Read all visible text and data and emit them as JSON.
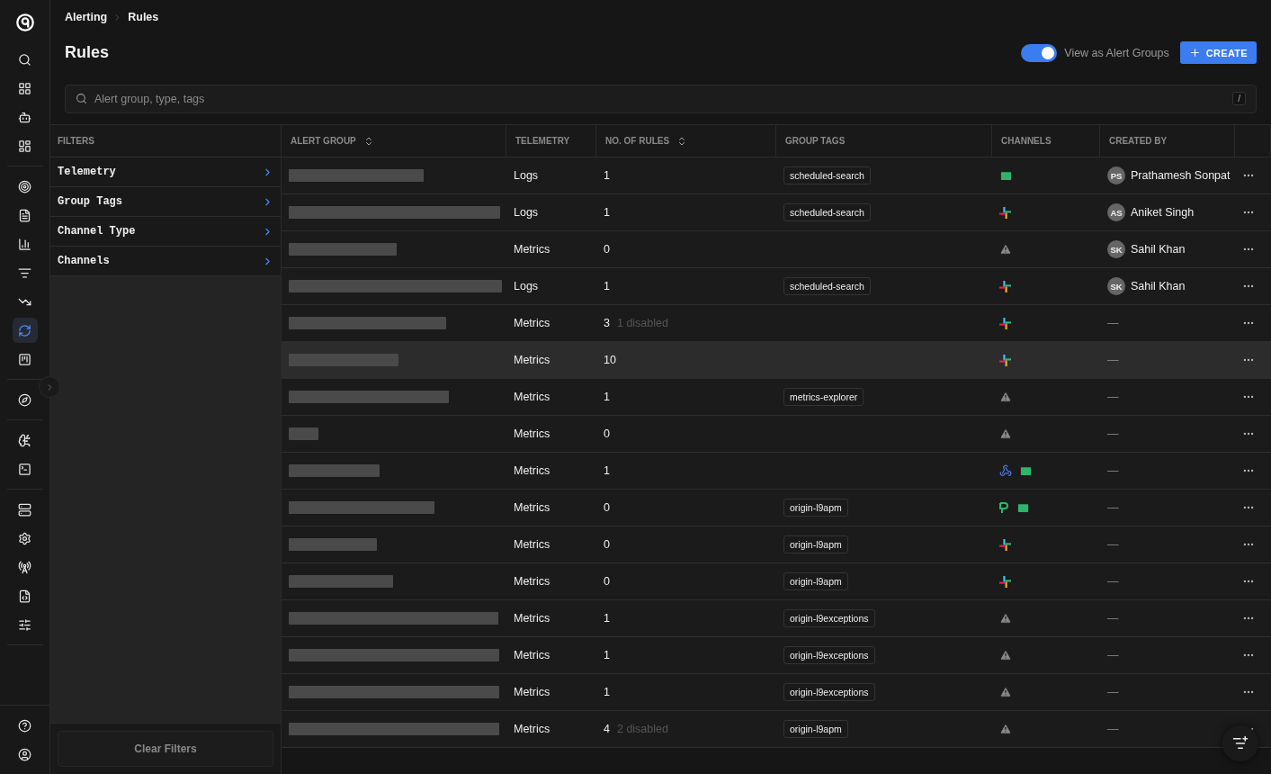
{
  "nav": {
    "top": [
      {
        "kind": "search",
        "selected": false
      },
      {
        "kind": "apps",
        "selected": false
      },
      {
        "kind": "bot",
        "selected": false
      },
      {
        "kind": "dashboard",
        "selected": false
      }
    ],
    "groups": [
      [
        {
          "kind": "target",
          "selected": false
        },
        {
          "kind": "logs",
          "selected": false
        },
        {
          "kind": "chart",
          "selected": false
        },
        {
          "kind": "traces",
          "selected": false
        },
        {
          "kind": "trend",
          "selected": false
        },
        {
          "kind": "alert",
          "selected": true
        },
        {
          "kind": "board",
          "selected": false
        }
      ],
      [
        {
          "kind": "compass",
          "selected": false
        }
      ],
      [
        {
          "kind": "brain",
          "selected": false
        },
        {
          "kind": "terminal",
          "selected": false
        }
      ],
      [
        {
          "kind": "server",
          "selected": false
        },
        {
          "kind": "gear",
          "selected": false
        },
        {
          "kind": "radio",
          "selected": false
        },
        {
          "kind": "code",
          "selected": false
        },
        {
          "kind": "sliders",
          "selected": false
        }
      ]
    ],
    "bottom": [
      {
        "kind": "help",
        "selected": false
      },
      {
        "kind": "user",
        "selected": false
      }
    ]
  },
  "breadcrumb": [
    "Alerting",
    "Rules"
  ],
  "title": "Rules",
  "view_toggle": {
    "label": "View as Alert Groups",
    "on": true
  },
  "create_button": "CREATE",
  "search": {
    "placeholder": "Alert group, type, tags",
    "shortcut": "/"
  },
  "filters": {
    "heading": "FILTERS",
    "items": [
      "Telemetry",
      "Group Tags",
      "Channel Type",
      "Channels"
    ],
    "clear_button": "Clear Filters"
  },
  "table": {
    "columns": [
      {
        "label": "ALERT GROUP",
        "sortable": true
      },
      {
        "label": "TELEMETRY",
        "sortable": false
      },
      {
        "label": "NO. OF RULES",
        "sortable": true
      },
      {
        "label": "GROUP TAGS",
        "sortable": false
      },
      {
        "label": "CHANNELS",
        "sortable": false
      },
      {
        "label": "CREATED BY",
        "sortable": false
      }
    ],
    "rows": [
      {
        "telemetry": "Logs",
        "rules": "1",
        "tags": [
          "scheduled-search"
        ],
        "channels": [
          {
            "kind": "email"
          }
        ],
        "creator": {
          "initials": "PS",
          "name": "Prathamesh Sonpat"
        },
        "hovered": false
      },
      {
        "telemetry": "Logs",
        "rules": "1",
        "tags": [
          "scheduled-search"
        ],
        "channels": [
          {
            "kind": "slack"
          }
        ],
        "creator": {
          "initials": "AS",
          "name": "Aniket Singh"
        },
        "hovered": false
      },
      {
        "telemetry": "Metrics",
        "rules": "0",
        "tags": [],
        "channels": [
          {
            "kind": "default"
          }
        ],
        "creator": {
          "initials": "SK",
          "name": "Sahil Khan"
        },
        "hovered": false
      },
      {
        "telemetry": "Logs",
        "rules": "1",
        "tags": [
          "scheduled-search"
        ],
        "channels": [
          {
            "kind": "slack"
          }
        ],
        "creator": {
          "initials": "SK",
          "name": "Sahil Khan"
        },
        "hovered": false
      },
      {
        "telemetry": "Metrics",
        "rules": "3",
        "disabled": "1 disabled",
        "tags": [],
        "channels": [
          {
            "kind": "slack"
          }
        ],
        "no_creator": "—",
        "hovered": false
      },
      {
        "telemetry": "Metrics",
        "rules": "10",
        "tags": [],
        "channels": [
          {
            "kind": "slack"
          }
        ],
        "no_creator": "—",
        "hovered": true
      },
      {
        "telemetry": "Metrics",
        "rules": "1",
        "tags": [
          "metrics-explorer"
        ],
        "channels": [
          {
            "kind": "default"
          }
        ],
        "no_creator": "—",
        "hovered": false
      },
      {
        "telemetry": "Metrics",
        "rules": "0",
        "tags": [],
        "channels": [
          {
            "kind": "default"
          }
        ],
        "no_creator": "—",
        "hovered": false
      },
      {
        "telemetry": "Metrics",
        "rules": "1",
        "tags": [],
        "channels": [
          {
            "kind": "webhook"
          },
          {
            "kind": "email"
          }
        ],
        "no_creator": "—",
        "hovered": false
      },
      {
        "telemetry": "Metrics",
        "rules": "0",
        "tags": [
          "origin-l9apm"
        ],
        "channels": [
          {
            "kind": "pagerduty"
          },
          {
            "kind": "email"
          }
        ],
        "no_creator": "—",
        "hovered": false
      },
      {
        "telemetry": "Metrics",
        "rules": "0",
        "tags": [
          "origin-l9apm"
        ],
        "channels": [
          {
            "kind": "slack"
          }
        ],
        "no_creator": "—",
        "hovered": false
      },
      {
        "telemetry": "Metrics",
        "rules": "0",
        "tags": [
          "origin-l9apm"
        ],
        "channels": [
          {
            "kind": "slack"
          }
        ],
        "no_creator": "—",
        "hovered": false
      },
      {
        "telemetry": "Metrics",
        "rules": "1",
        "tags": [
          "origin-l9exceptions"
        ],
        "channels": [
          {
            "kind": "default"
          }
        ],
        "no_creator": "—",
        "hovered": false
      },
      {
        "telemetry": "Metrics",
        "rules": "1",
        "tags": [
          "origin-l9exceptions"
        ],
        "channels": [
          {
            "kind": "default"
          }
        ],
        "no_creator": "—",
        "hovered": false
      },
      {
        "telemetry": "Metrics",
        "rules": "1",
        "tags": [
          "origin-l9exceptions"
        ],
        "channels": [
          {
            "kind": "default"
          }
        ],
        "no_creator": "—",
        "hovered": false
      },
      {
        "telemetry": "Metrics",
        "rules": "4",
        "disabled": "2 disabled",
        "tags": [
          "origin-l9apm"
        ],
        "channels": [
          {
            "kind": "default"
          }
        ],
        "no_creator": "—",
        "hovered": false
      }
    ]
  }
}
